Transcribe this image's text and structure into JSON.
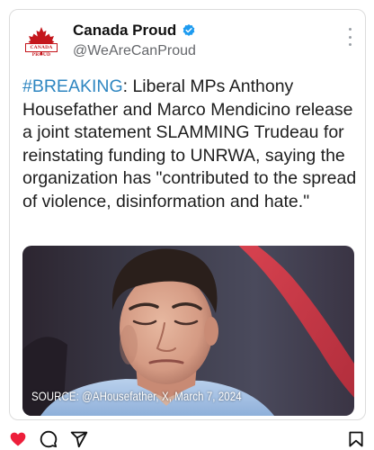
{
  "post": {
    "account_name": "Canada Proud",
    "handle": "@WeAreCanProud",
    "logo_text": "CANADA PROUD",
    "hashtag": "#BREAKING",
    "body": ": Liberal MPs Anthony Housefather and Marco Mendicino release a joint statement SLAMMING Trudeau for reinstating funding to UNRWA, saying the organization has \"contributed to the spread of violence, disinformation and hate.\"",
    "image_caption": "SOURCE: @AHousefather, X, March 7, 2024"
  },
  "icons": {
    "verified": "verified-badge-icon",
    "more": "more-vertical-icon",
    "like": "heart-icon",
    "comment": "comment-icon",
    "share": "send-icon",
    "save": "bookmark-icon"
  },
  "colors": {
    "hashtag": "#2e86c1",
    "verified": "#1d9bf0",
    "like": "#ed1e3a",
    "brand": "#c4161c"
  }
}
